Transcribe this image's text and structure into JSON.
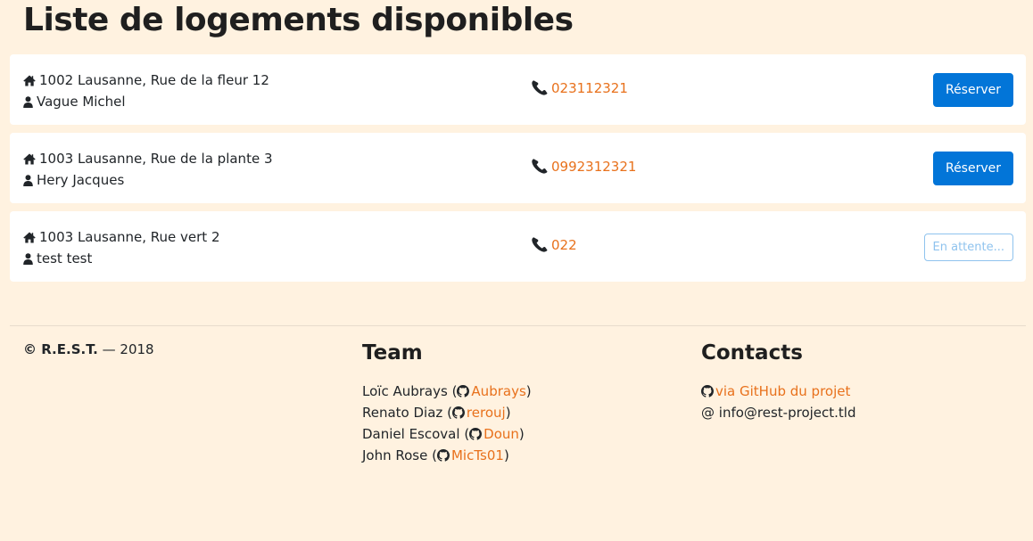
{
  "page": {
    "title": "Liste de logements disponibles"
  },
  "listings": [
    {
      "address": "1002 Lausanne, Rue de la fleur 12",
      "owner": "Vague Michel",
      "phone": "023112321",
      "action_label": "Réserver",
      "status": "available"
    },
    {
      "address": "1003 Lausanne, Rue de la plante 3",
      "owner": "Hery Jacques",
      "phone": "0992312321",
      "action_label": "Réserver",
      "status": "available"
    },
    {
      "address": "1003 Lausanne, Rue vert 2",
      "owner": "test test",
      "phone": "022",
      "action_label": "En attente...",
      "status": "pending"
    }
  ],
  "footer": {
    "copyright_symbol_name": "© R.E.S.T.",
    "copyright_sep": "—",
    "copyright_year": "2018",
    "team_title": "Team",
    "team": [
      {
        "name": "Loïc Aubrays",
        "github": "Aubrays"
      },
      {
        "name": "Renato Diaz",
        "github": "rerouj"
      },
      {
        "name": "Daniel Escoval",
        "github": "Doun"
      },
      {
        "name": "John Rose",
        "github": "MicTs01"
      }
    ],
    "contacts_title": "Contacts",
    "contacts": {
      "github_link": "via GitHub du projet",
      "email": "info@rest-project.tld"
    }
  },
  "colors": {
    "background": "#fff2e0",
    "link": "#e8711c",
    "primary_button": "#0275d8",
    "pending_button": "#8fc3ee"
  },
  "icons": {
    "address": "home-icon",
    "owner": "user-icon",
    "phone": "phone-icon",
    "github": "github-icon",
    "email": "at-icon"
  }
}
